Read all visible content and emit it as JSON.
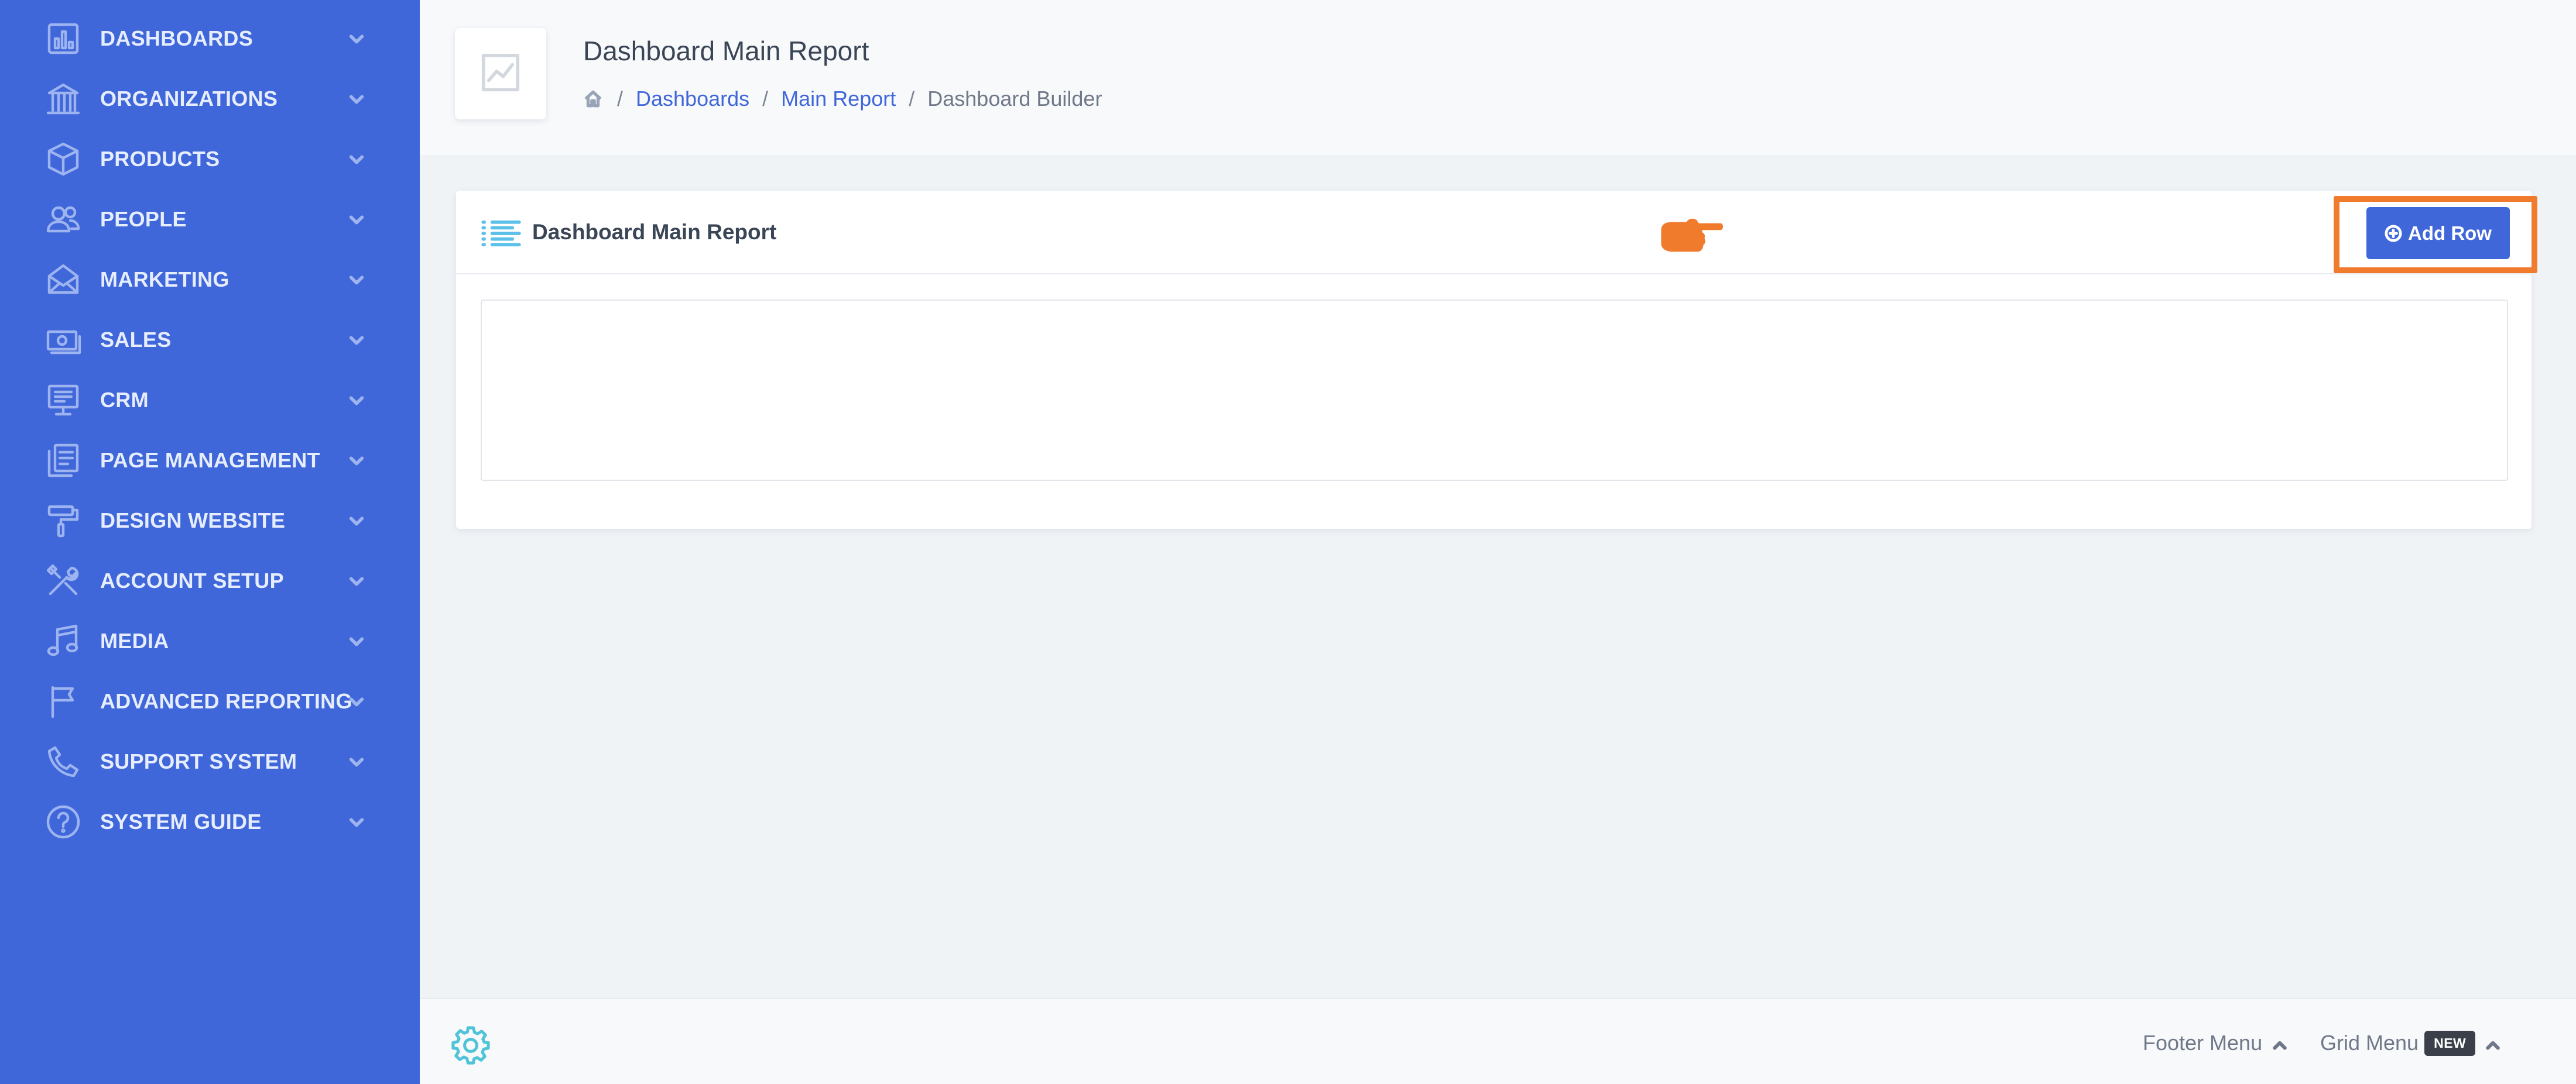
{
  "sidebar": {
    "items": [
      {
        "label": "DASHBOARDS",
        "icon": "bar-chart-icon"
      },
      {
        "label": "ORGANIZATIONS",
        "icon": "building-icon"
      },
      {
        "label": "PRODUCTS",
        "icon": "box-icon"
      },
      {
        "label": "PEOPLE",
        "icon": "people-icon"
      },
      {
        "label": "MARKETING",
        "icon": "envelope-icon"
      },
      {
        "label": "SALES",
        "icon": "money-icon"
      },
      {
        "label": "CRM",
        "icon": "monitor-icon"
      },
      {
        "label": "PAGE MANAGEMENT",
        "icon": "pages-icon"
      },
      {
        "label": "DESIGN WEBSITE",
        "icon": "paint-roller-icon"
      },
      {
        "label": "ACCOUNT SETUP",
        "icon": "tools-icon"
      },
      {
        "label": "MEDIA",
        "icon": "music-note-icon"
      },
      {
        "label": "ADVANCED REPORTING",
        "icon": "flag-icon"
      },
      {
        "label": "SUPPORT SYSTEM",
        "icon": "phone-icon"
      },
      {
        "label": "SYSTEM GUIDE",
        "icon": "help-circle-icon"
      }
    ]
  },
  "header": {
    "title": "Dashboard Main Report",
    "breadcrumb": {
      "home_icon": "home-icon",
      "separator": "/",
      "links": [
        "Dashboards",
        "Main Report"
      ],
      "current": "Dashboard Builder"
    }
  },
  "card": {
    "title": "Dashboard Main Report",
    "add_row_label": "Add Row"
  },
  "footer": {
    "footer_menu_label": "Footer Menu",
    "grid_menu_label": "Grid Menu",
    "new_badge": "NEW"
  },
  "colors": {
    "sidebar_bg": "#4067d9",
    "accent": "#4067d9",
    "highlight": "#f07b2d"
  }
}
